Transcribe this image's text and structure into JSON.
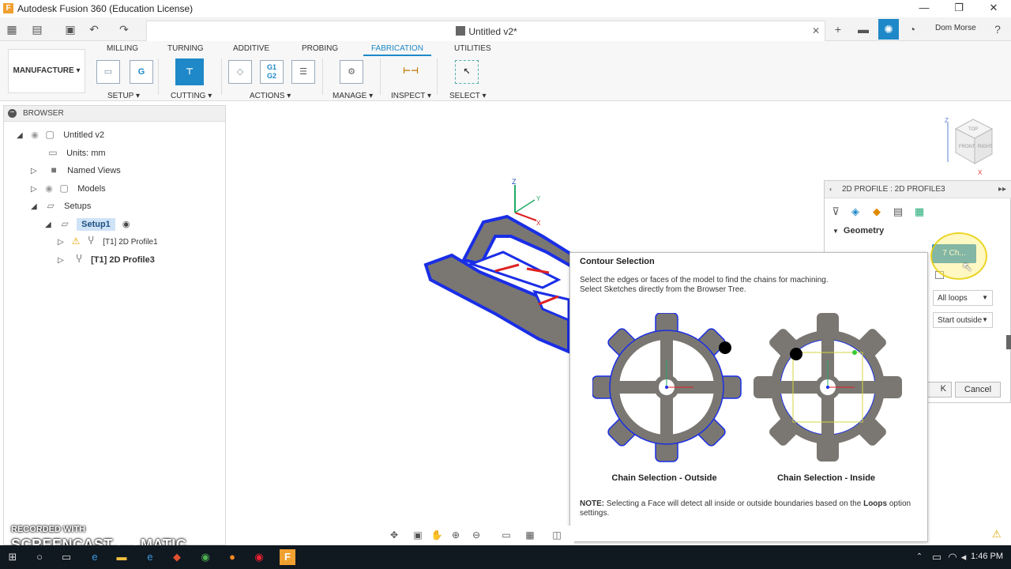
{
  "window": {
    "title": "Autodesk Fusion 360 (Education License)",
    "logo": "F"
  },
  "document": {
    "title": "Untitled v2*"
  },
  "user": {
    "name": "Dom Morse"
  },
  "ribbon": {
    "workspace": "MANUFACTURE",
    "tabs": [
      "MILLING",
      "TURNING",
      "ADDITIVE",
      "PROBING",
      "FABRICATION",
      "UTILITIES"
    ],
    "active_tab": "FABRICATION",
    "groups": [
      "SETUP",
      "CUTTING",
      "ACTIONS",
      "MANAGE",
      "INSPECT",
      "SELECT"
    ],
    "g1g2": "G1\nG2"
  },
  "browser": {
    "title": "BROWSER",
    "root": "Untitled v2",
    "units": "Units: mm",
    "named_views": "Named Views",
    "models": "Models",
    "setups": "Setups",
    "setup1": "Setup1",
    "op1": "[T1] 2D Profile1",
    "op2": "[T1] 2D Profile3"
  },
  "profile_panel": {
    "title": "2D PROFILE : 2D PROFILE3",
    "geometry_heading": "Geometry",
    "chain_button": "7 Ch...",
    "loops_value": "All loops",
    "side_value": "Start outside",
    "cancel_label": "Cancel",
    "ok_label": "K"
  },
  "tooltip": {
    "title": "Contour Selection",
    "desc1": "Select the edges or faces of the model to find the chains for machining.",
    "desc2": "Select Sketches directly from the Browser Tree.",
    "caption_outside": "Chain Selection - Outside",
    "caption_inside": "Chain Selection - Inside",
    "note_label": "NOTE:",
    "note_part1": " Selecting a Face will detect all inside or outside boundaries based on the ",
    "note_loops": "Loops",
    "note_part2": " option settings."
  },
  "viewcube": {
    "top": "TOP",
    "front": "FRONT",
    "right": "RIGHT"
  },
  "axis": {
    "z": "Z",
    "x": "X",
    "y": "Y"
  },
  "taskbar": {
    "time": "1:46 PM"
  },
  "watermark": {
    "line1": "RECORDED WITH",
    "line2": "SCREENCAST",
    "line3": "MATIC"
  },
  "colors": {
    "accent": "#1e88c8",
    "model_edge": "#1a2ee6",
    "model_face": "#7a7772",
    "warning": "#e8a800"
  }
}
